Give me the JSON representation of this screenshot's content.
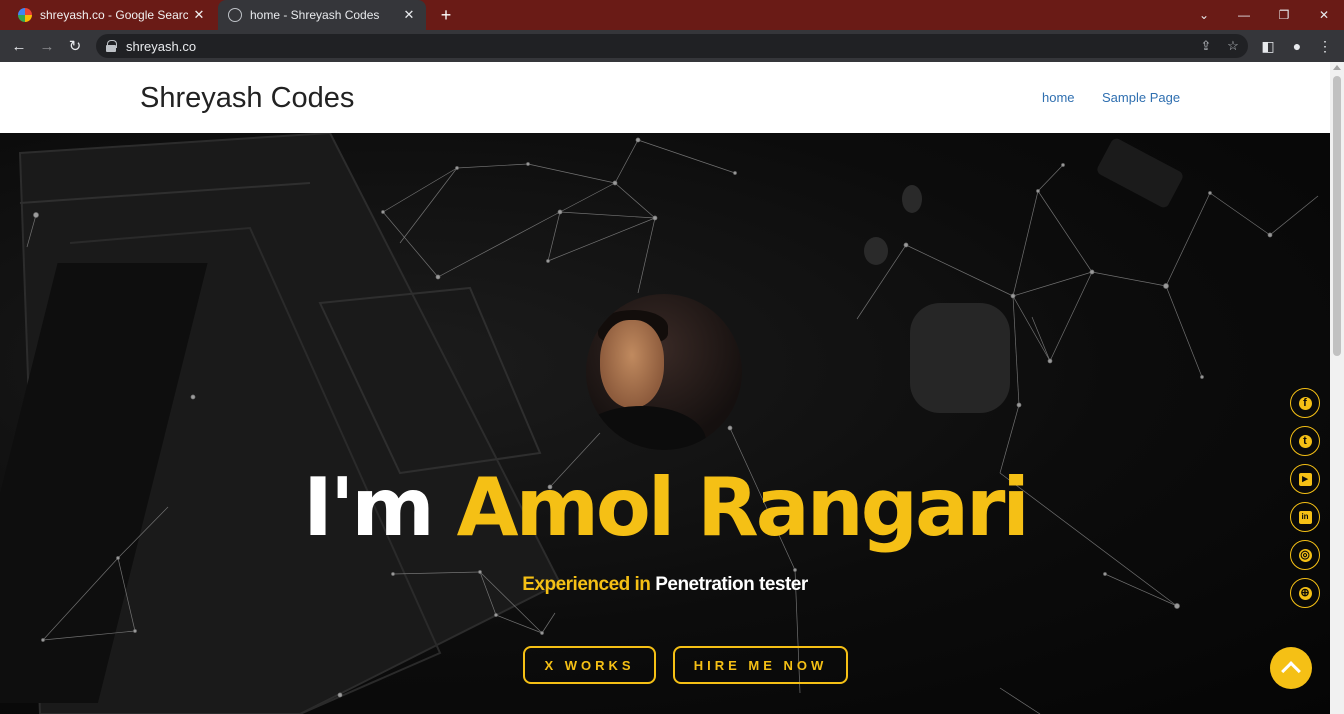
{
  "browser": {
    "tabs": [
      {
        "label": "shreyash.co - Google Search",
        "close": "✕"
      },
      {
        "label": "home - Shreyash Codes",
        "close": "✕"
      }
    ],
    "new_tab": "+",
    "window_controls": [
      "⌄",
      "—",
      "❐",
      "✕"
    ],
    "url": "shreyash.co",
    "nav_icons": {
      "back": "←",
      "forward": "→",
      "reload": "↻"
    },
    "omni_icons": {
      "share": "⇪",
      "bookmark": "☆"
    },
    "toolbar_icons": {
      "side_panel": "◧",
      "profile": "●",
      "menu": "⋮"
    }
  },
  "site": {
    "title": "Shreyash Codes",
    "nav": [
      "home",
      "Sample Page"
    ]
  },
  "hero": {
    "headline_prefix": "I'm",
    "headline_name": "Amol Rangari",
    "subline_prefix": "Experienced in",
    "subline_role": "Penetration tester",
    "buttons": [
      "X WORKS",
      "HIRE ME NOW"
    ],
    "social_icons": [
      {
        "name": "facebook-icon",
        "glyph": "f"
      },
      {
        "name": "twitter-icon",
        "glyph": "t"
      },
      {
        "name": "youtube-icon",
        "glyph": "▸"
      },
      {
        "name": "linkedin-icon",
        "glyph": "in"
      },
      {
        "name": "instagram-icon",
        "glyph": "◎"
      },
      {
        "name": "dribbble-icon",
        "glyph": "⊕"
      }
    ]
  },
  "colors": {
    "accent": "#f5c015",
    "tabbar": "#6a1b16",
    "link": "#2f6fb0"
  }
}
